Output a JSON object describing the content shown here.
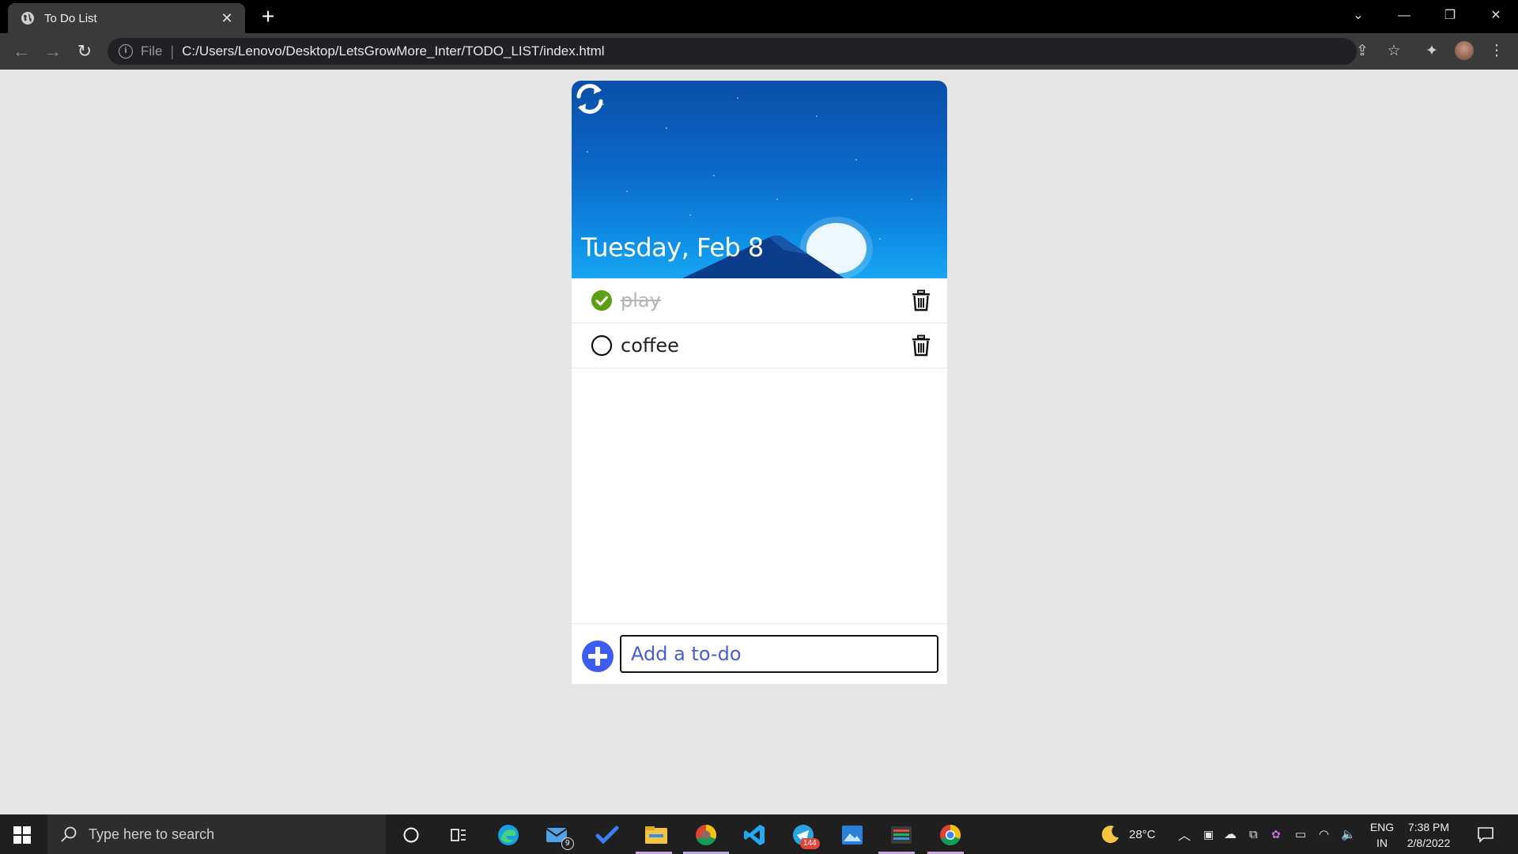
{
  "browser": {
    "tab_title": "To Do List",
    "tab_close": "✕",
    "new_tab": "+",
    "address_scheme": "File",
    "address_url": "C:/Users/Lenovo/Desktop/LetsGrowMore_Inter/TODO_LIST/index.html",
    "icons": [
      "back-arrow-icon",
      "forward-arrow-icon",
      "reload-icon",
      "info-icon",
      "share-icon",
      "star-icon",
      "extensions-icon",
      "profile-avatar",
      "more-menu-icon"
    ]
  },
  "app": {
    "date": "Tuesday, Feb 8",
    "todos": [
      {
        "text": "play",
        "done": true
      },
      {
        "text": "coffee",
        "done": false
      }
    ],
    "input_placeholder": "Add a to-do",
    "colors": {
      "check_done": "#5aa012",
      "add_button": "#3d5cf0",
      "hero_top": "#0a4fa8",
      "hero_bottom": "#17a6f2"
    }
  },
  "taskbar": {
    "search_placeholder": "Type here to search",
    "weather_temp": "28°C",
    "lang_top": "ENG",
    "lang_bottom": "IN",
    "time": "7:38 PM",
    "date": "2/8/2022",
    "mail_badge": "9",
    "telegram_badge": "144"
  }
}
